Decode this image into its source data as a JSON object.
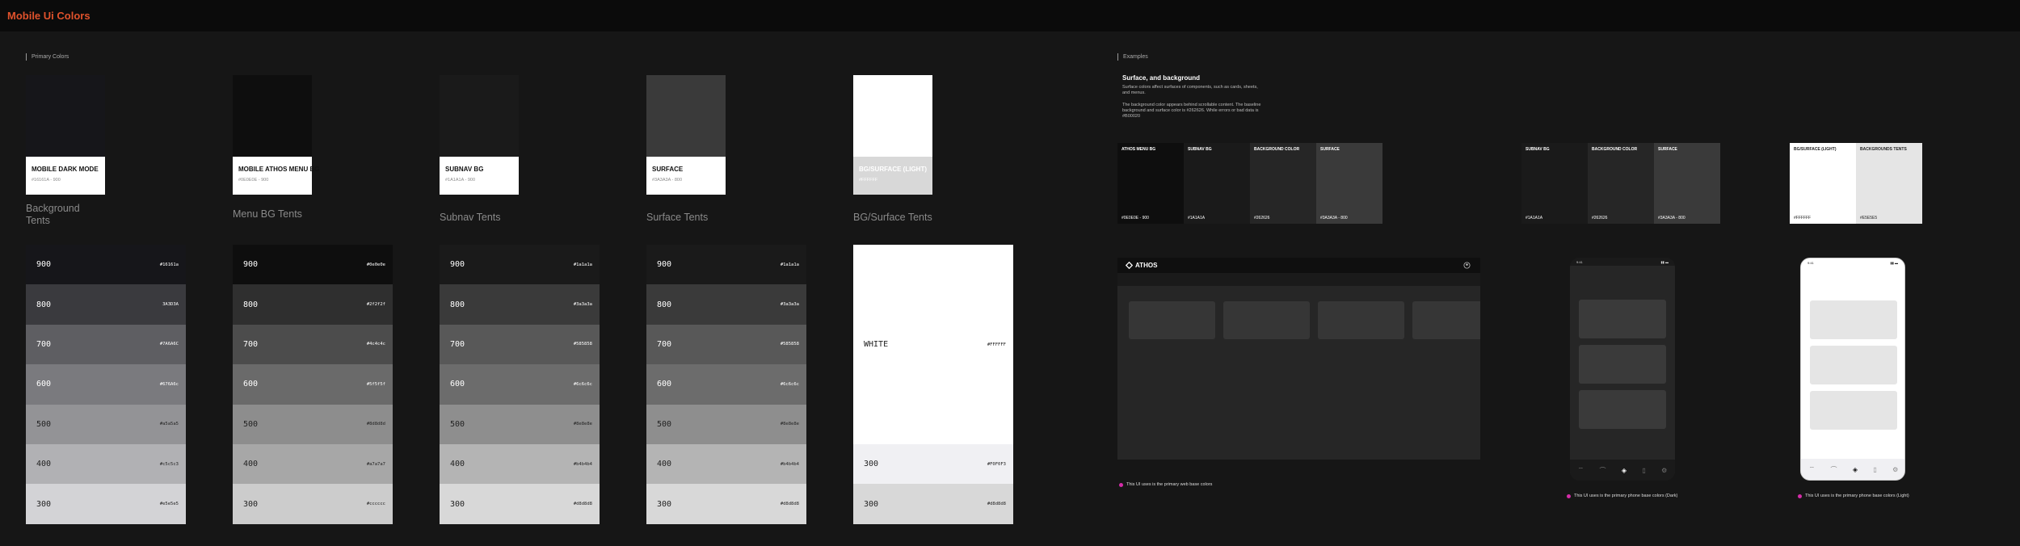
{
  "page_title": "Mobile Ui Colors",
  "sections": {
    "primary": "Primary Colors",
    "examples": "Examples"
  },
  "swatches": [
    {
      "name": "MOBILE DARK MODE",
      "hex": "#16161A - 900",
      "color": "#16161a",
      "light": false
    },
    {
      "name": "MOBILE ATHOS MENU BG",
      "hex": "#0E0E0E - 900",
      "color": "#0e0e0e",
      "light": false
    },
    {
      "name": "SUBNAV BG",
      "hex": "#1A1A1A - 900",
      "color": "#1a1a1a",
      "light": false
    },
    {
      "name": "SURFACE",
      "hex": "#3A3A3A - 800",
      "color": "#3a3a3a",
      "light": false
    },
    {
      "name": "BG/SURFACE (LIGHT)",
      "hex": "#FFFFFF",
      "color": "#ffffff",
      "light": true
    }
  ],
  "tent_titles": [
    "Background Tents",
    "Menu BG Tents",
    "Subnav Tents",
    "Surface Tents",
    "BG/Surface Tents"
  ],
  "tents": [
    [
      {
        "label": "900",
        "hex": "#16161a",
        "color": "#16161a"
      },
      {
        "label": "800",
        "hex": "3A3D3A",
        "color": "#3a3a3e"
      },
      {
        "label": "700",
        "hex": "#7A6A6C",
        "color": "#5e5e62"
      },
      {
        "label": "600",
        "hex": "#676A6c",
        "color": "#7a7a7e"
      },
      {
        "label": "500",
        "hex": "#a5a5a5",
        "color": "#939396"
      },
      {
        "label": "400",
        "hex": "#c5c5c3",
        "color": "#b1b1b4"
      },
      {
        "label": "300",
        "hex": "#e5e5e5",
        "color": "#d3d3d6"
      }
    ],
    [
      {
        "label": "900",
        "hex": "#0e0e0e",
        "color": "#0e0e0e"
      },
      {
        "label": "800",
        "hex": "#2f2f2f",
        "color": "#2f2f2f"
      },
      {
        "label": "700",
        "hex": "#4c4c4c",
        "color": "#4c4c4c"
      },
      {
        "label": "600",
        "hex": "#5f5f5f",
        "color": "#6a6a6a"
      },
      {
        "label": "500",
        "hex": "#8d8d8d",
        "color": "#8d8d8d"
      },
      {
        "label": "400",
        "hex": "#a7a7a7",
        "color": "#a7a7a7"
      },
      {
        "label": "300",
        "hex": "#cccccc",
        "color": "#cccccc"
      }
    ],
    [
      {
        "label": "900",
        "hex": "#1a1a1a",
        "color": "#1a1a1a"
      },
      {
        "label": "800",
        "hex": "#3a3a3a",
        "color": "#3a3a3a"
      },
      {
        "label": "700",
        "hex": "#585858",
        "color": "#585858"
      },
      {
        "label": "600",
        "hex": "#6c6c6c",
        "color": "#6c6c6c"
      },
      {
        "label": "500",
        "hex": "#8e8e8e",
        "color": "#8e8e8e"
      },
      {
        "label": "400",
        "hex": "#b4b4b4",
        "color": "#b4b4b4"
      },
      {
        "label": "300",
        "hex": "#d8d8d8",
        "color": "#d8d8d8"
      }
    ],
    [
      {
        "label": "900",
        "hex": "#1a1a1a",
        "color": "#1a1a1a"
      },
      {
        "label": "800",
        "hex": "#3a3a3a",
        "color": "#3a3a3a"
      },
      {
        "label": "700",
        "hex": "#585858",
        "color": "#585858"
      },
      {
        "label": "600",
        "hex": "#6c6c6c",
        "color": "#6c6c6c"
      },
      {
        "label": "500",
        "hex": "#8e8e8e",
        "color": "#8e8e8e"
      },
      {
        "label": "400",
        "hex": "#b4b4b4",
        "color": "#b4b4b4"
      },
      {
        "label": "300",
        "hex": "#d8d8d8",
        "color": "#d8d8d8"
      }
    ]
  ],
  "light_tents": [
    {
      "label": "WHITE",
      "hex": "#FFFFFF",
      "color": "#ffffff"
    },
    {
      "label": "300",
      "hex": "#F0F0F3",
      "color": "#f0f0f3"
    },
    {
      "label": "300",
      "hex": "#d8d8d8",
      "color": "#d8d8d8"
    }
  ],
  "examples": {
    "heading": "Surface, and background",
    "para1": "Surface colors affect surfaces of components, such as cards, sheets, and menus.",
    "para2": "The background color appears behind scrollable content. The baseline background and surface color is #262626. While errors or bad data is #B00020",
    "web_group": [
      {
        "label": "ATHOS MENU BG",
        "hex": "#0E0E0E - 900",
        "color": "#0e0e0e"
      },
      {
        "label": "SUBNAV BG",
        "hex": "#1A1A1A",
        "color": "#1a1a1a"
      },
      {
        "label": "BACKGROUND COLOR",
        "hex": "#262626",
        "color": "#262626"
      },
      {
        "label": "SURFACE",
        "hex": "#3A3A3A - 800",
        "color": "#3a3a3a"
      }
    ],
    "dark_group": [
      {
        "label": "SUBNAV BG",
        "hex": "#1A1A1A",
        "color": "#1a1a1a"
      },
      {
        "label": "BACKGROUND COLOR",
        "hex": "#262626",
        "color": "#262626"
      },
      {
        "label": "SURFACE",
        "hex": "#3A3A3A - 800",
        "color": "#3a3a3a"
      }
    ],
    "light_group": [
      {
        "label": "BG/SURFACE (LIGHT)",
        "hex": "#FFFFFF",
        "color": "#ffffff"
      },
      {
        "label": "BACKGROUNDS TENTS",
        "hex": "#E5E5E5",
        "color": "#e5e5e5"
      }
    ],
    "web_logo": "ATHOS",
    "phone_time": "9:41",
    "caption_web": "This UI uses is the primary web base colors",
    "caption_dark": "This UI uses is the primary phone base colors (Dark)",
    "caption_light": "This UI uses is the primary phone base colors (Light)"
  }
}
